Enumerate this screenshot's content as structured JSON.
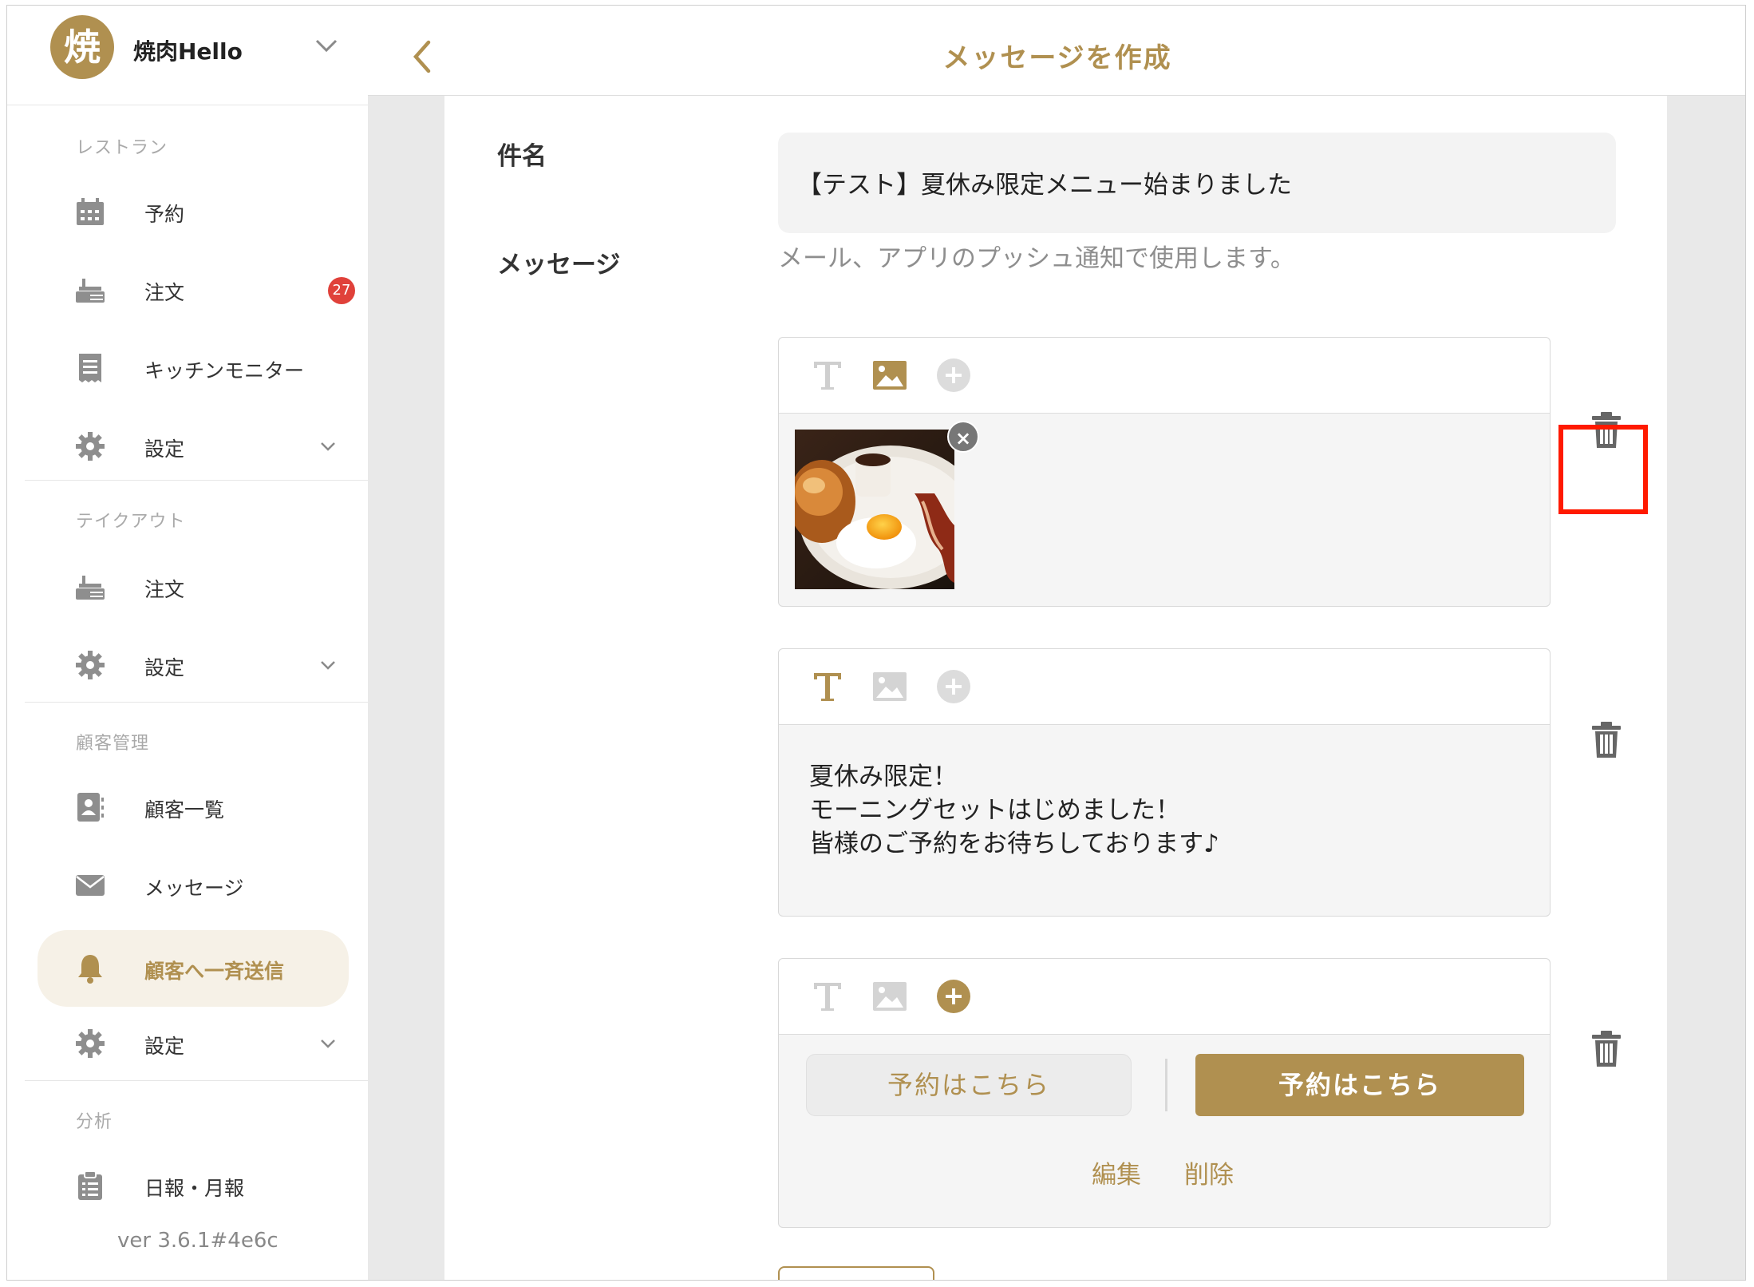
{
  "sidebar": {
    "brand": {
      "logo_char": "焼",
      "name": "焼肉Hello"
    },
    "sections": [
      {
        "title": "レストラン",
        "items": [
          {
            "label": "予約",
            "icon": "calendar-icon"
          },
          {
            "label": "注文",
            "icon": "order-icon",
            "badge": "27"
          },
          {
            "label": "キッチンモニター",
            "icon": "receipt-icon"
          },
          {
            "label": "設定",
            "icon": "gear-icon"
          }
        ]
      },
      {
        "title": "テイクアウト",
        "items": [
          {
            "label": "注文",
            "icon": "order-icon"
          },
          {
            "label": "設定",
            "icon": "gear-icon"
          }
        ]
      },
      {
        "title": "顧客管理",
        "items": [
          {
            "label": "顧客一覧",
            "icon": "contact-card-icon"
          },
          {
            "label": "メッセージ",
            "icon": "envelope-icon"
          },
          {
            "label": "顧客へ一斉送信",
            "icon": "bell-icon",
            "active": true
          },
          {
            "label": "設定",
            "icon": "gear-icon"
          }
        ]
      },
      {
        "title": "分析",
        "items": [
          {
            "label": "日報・月報",
            "icon": "clipboard-icon"
          }
        ]
      }
    ],
    "version": "ver 3.6.1#4e6c"
  },
  "header": {
    "title": "メッセージを作成"
  },
  "form": {
    "subject_label": "件名",
    "subject_value": "【テスト】夏休み限定メニュー始まりました",
    "subject_hint": "メール、アプリのプッシュ通知で使用します。",
    "message_label": "メッセージ",
    "blocks": [
      {
        "type": "image",
        "image_alt": "breakfast-photo"
      },
      {
        "type": "text",
        "text": "夏休み限定！\nモーニングセットはじめました！\n皆様のご予約をお待ちしております♪"
      },
      {
        "type": "button",
        "outline_label": "予約はこちら",
        "filled_label": "予約はこちら",
        "edit_label": "編集",
        "delete_label": "削除"
      }
    ]
  },
  "colors": {
    "accent": "#b09050",
    "badge": "#e0413a",
    "highlight": "#ff1a00"
  }
}
